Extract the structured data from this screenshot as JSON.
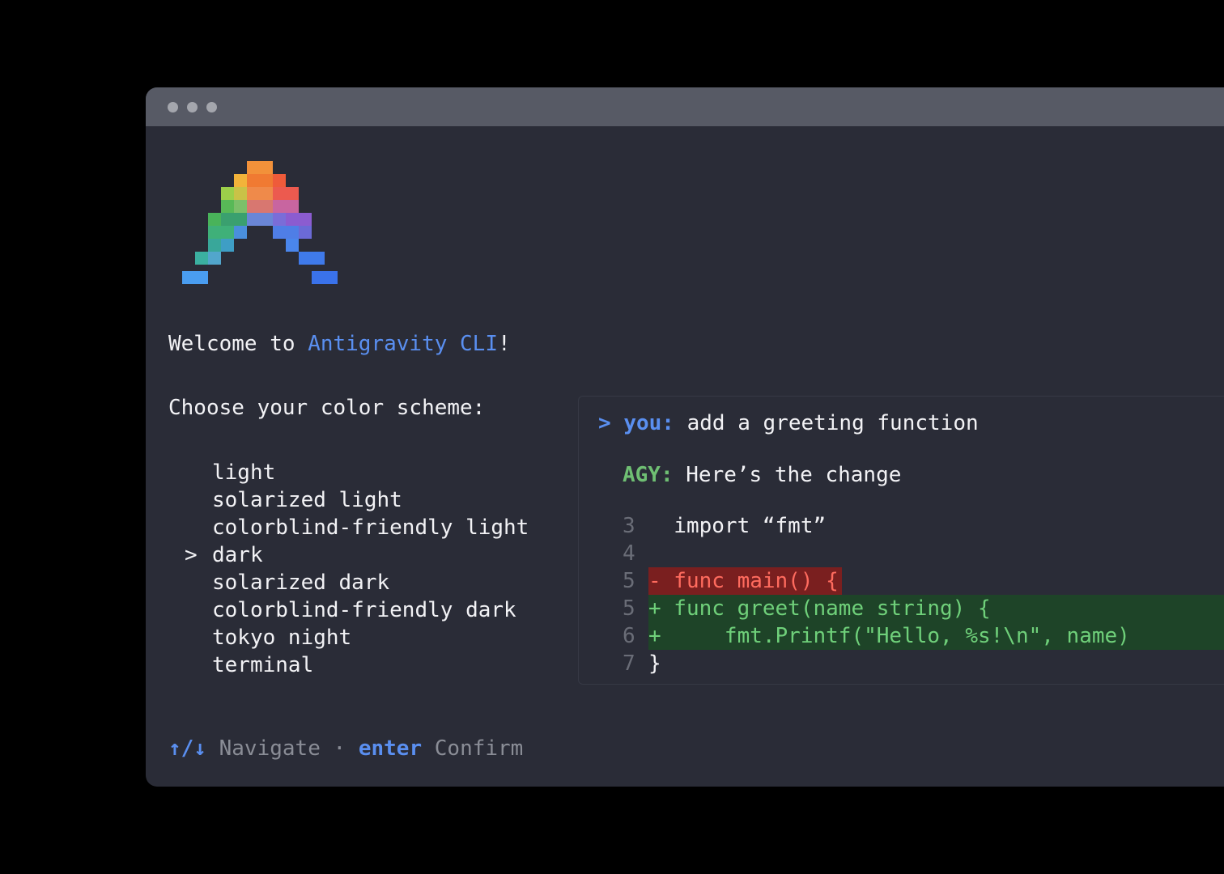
{
  "window": {
    "titlebar_dots": [
      "window-dot",
      "window-dot",
      "window-dot"
    ]
  },
  "logo": {
    "icon": "antigravity-pixel-logo-icon"
  },
  "welcome": {
    "prefix": "Welcome to ",
    "product": "Antigravity CLI",
    "suffix": "!"
  },
  "prompt": {
    "title": "Choose your color scheme:"
  },
  "schemes": {
    "marker": ">",
    "selected_index": 3,
    "items": [
      "light",
      "solarized light",
      "colorblind-friendly light",
      "dark",
      "solarized dark",
      "colorblind-friendly dark",
      "tokyo night",
      "terminal"
    ]
  },
  "footer": {
    "arrows": "↑/↓",
    "navigate": "Navigate",
    "separator": "·",
    "enter_key": "enter",
    "confirm": "Confirm"
  },
  "chat": {
    "you_prompt": ">",
    "you_label": "you:",
    "you_message": "add a greeting function",
    "agy_label": "AGY:",
    "agy_message": "Here’s the change",
    "code": [
      {
        "num": "3",
        "text": "  import “fmt”",
        "kind": "ctx"
      },
      {
        "num": "4",
        "text": "",
        "kind": "ctx"
      },
      {
        "num": "5",
        "text": "- func main() {",
        "kind": "del"
      },
      {
        "num": "5",
        "text": "+ func greet(name string) {",
        "kind": "add"
      },
      {
        "num": "6",
        "text": "+     fmt.Printf(\"Hello, %s!\\n\", name)",
        "kind": "add"
      },
      {
        "num": "7",
        "text": "}",
        "kind": "ctx"
      }
    ]
  },
  "colors": {
    "accent_blue": "#5a8ff0",
    "accent_green": "#6fbf73",
    "diff_del_bg": "#7a1f1f",
    "diff_add_bg": "#1e4428",
    "window_bg": "#2a2c37",
    "titlebar_bg": "#575a65"
  }
}
